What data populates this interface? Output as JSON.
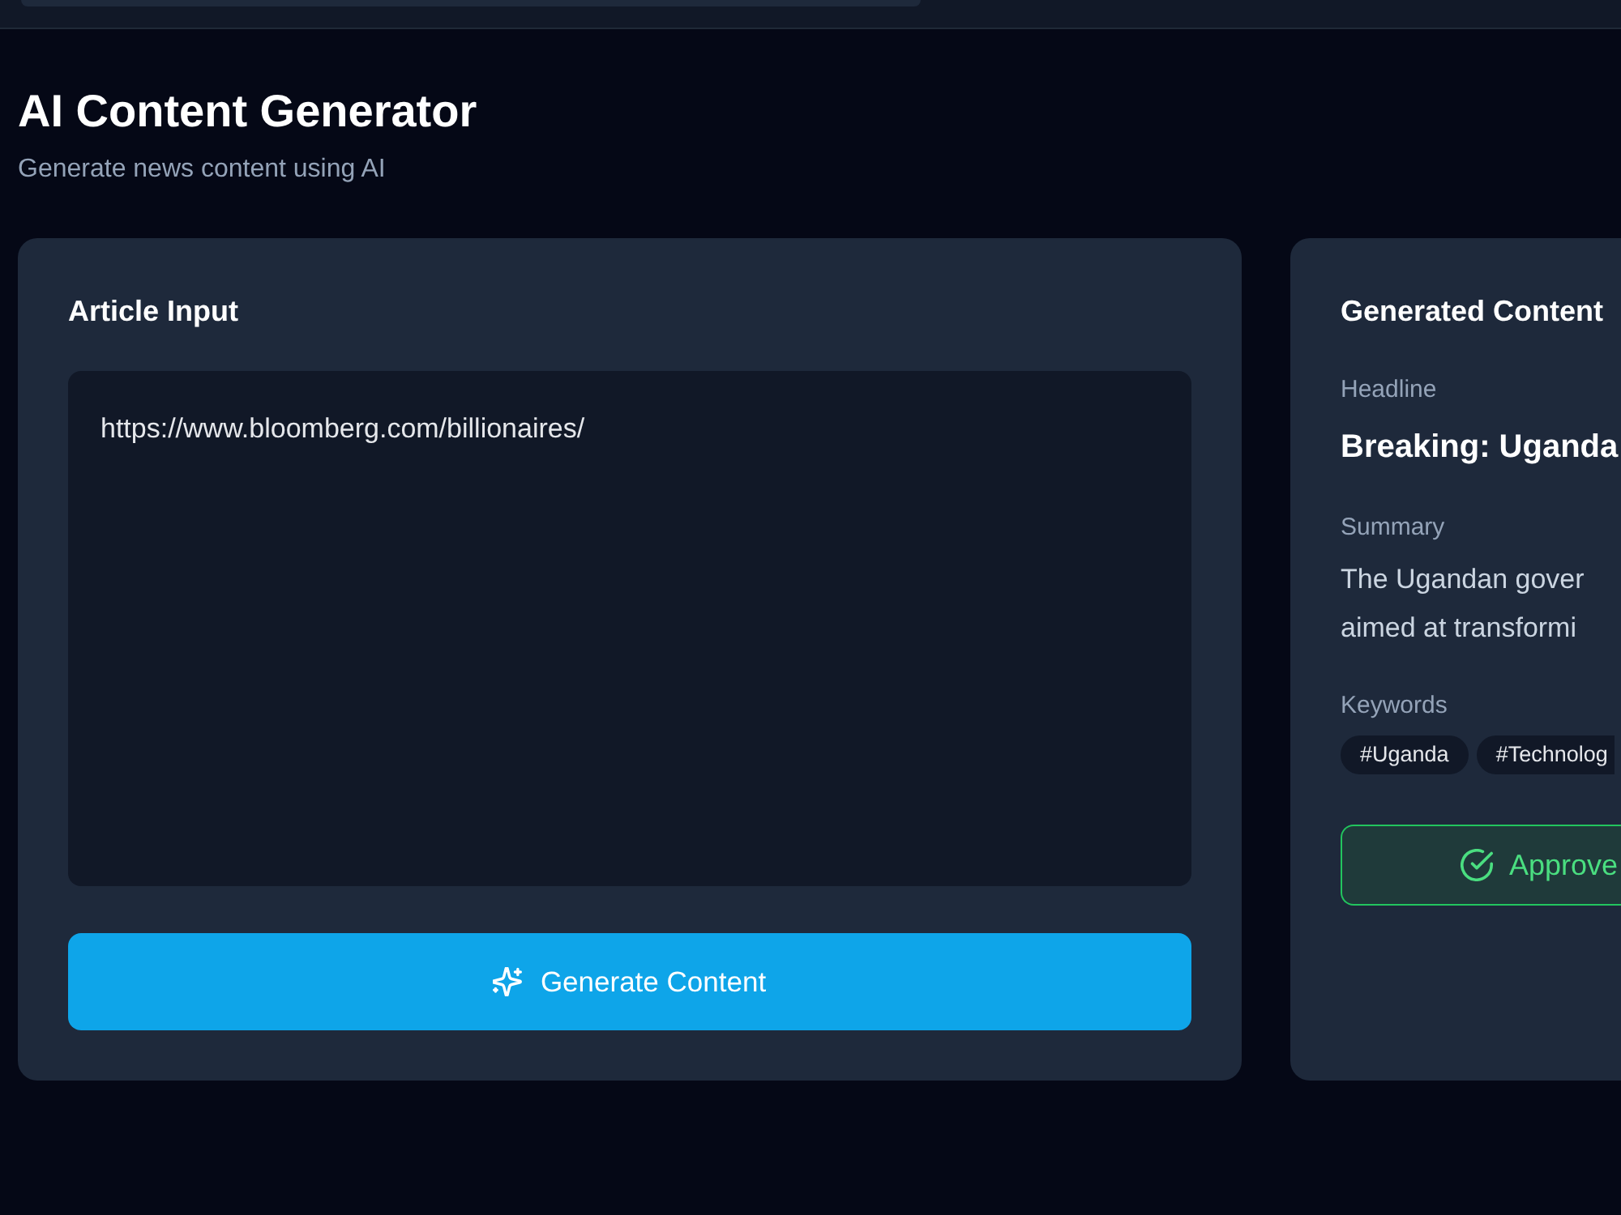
{
  "page": {
    "title": "AI Content Generator",
    "subtitle": "Generate news content using AI"
  },
  "input_panel": {
    "title": "Article Input",
    "article": {
      "value": "https://www.bloomberg.com/billionaires/"
    },
    "generate_button": {
      "label": "Generate Content"
    }
  },
  "output_panel": {
    "title": "Generated Content",
    "sections": [
      {
        "kind": "headline",
        "label": "Headline",
        "text": "Breaking: Uganda"
      },
      {
        "kind": "summary",
        "label": "Summary",
        "lines": [
          "The Ugandan gover",
          "aimed at transformi"
        ]
      },
      {
        "kind": "keywords",
        "label": "Keywords",
        "tags": [
          "#Uganda",
          "#Technolog"
        ]
      }
    ],
    "approve_button": {
      "label": "Approve"
    }
  }
}
